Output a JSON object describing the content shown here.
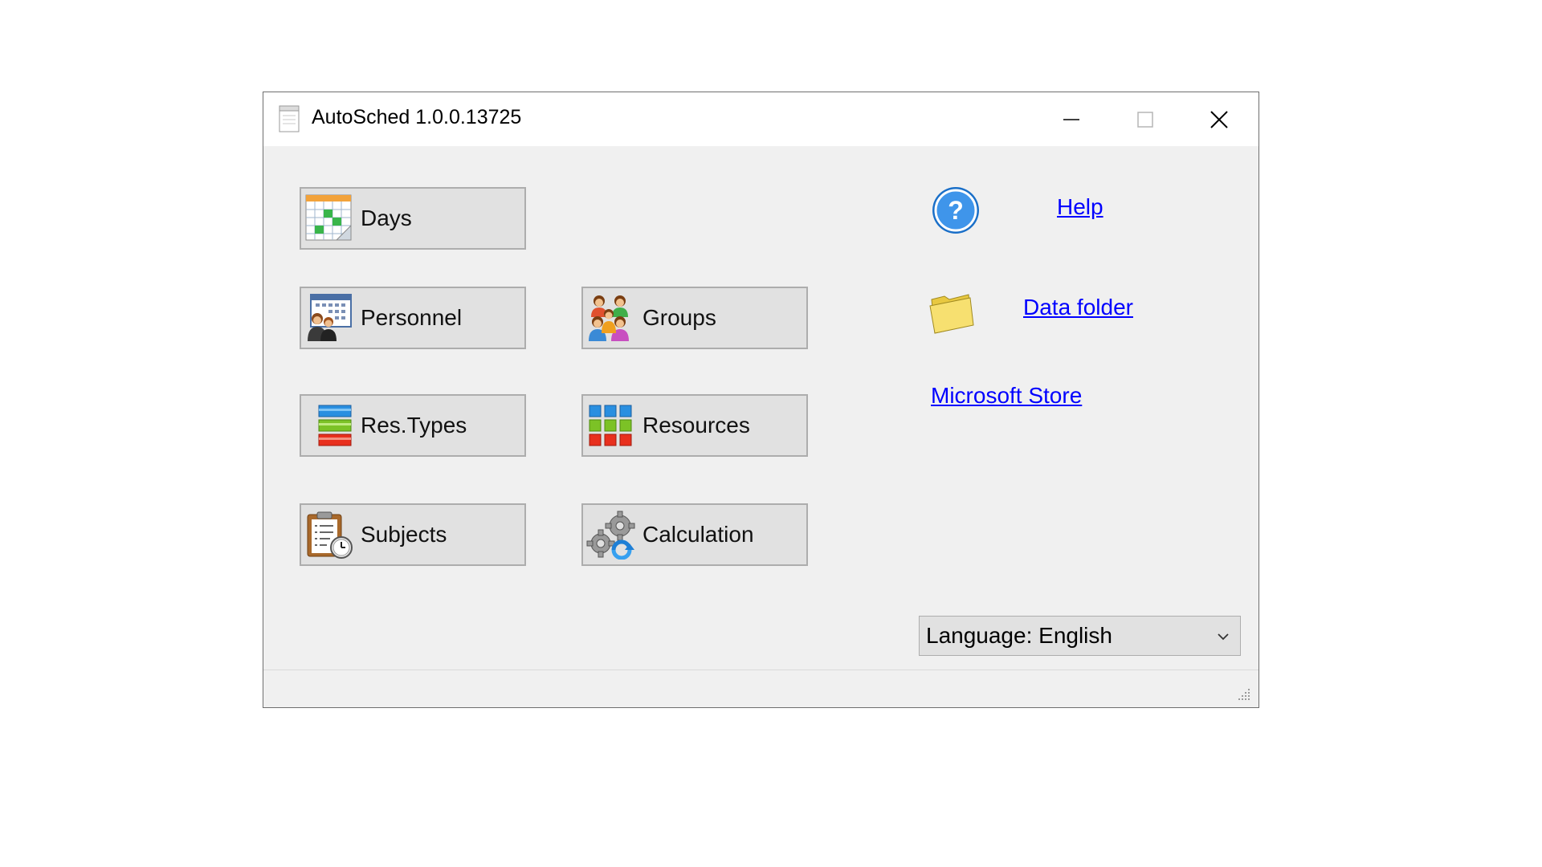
{
  "window": {
    "title": "AutoSched 1.0.0.13725"
  },
  "tiles": {
    "days": "Days",
    "personnel": "Personnel",
    "groups": "Groups",
    "res_types": "Res.Types",
    "resources": "Resources",
    "subjects": "Subjects",
    "calculation": "Calculation"
  },
  "links": {
    "help": "Help",
    "data_folder": "Data folder",
    "microsoft_store": "Microsoft Store"
  },
  "language": {
    "selected": "Language: English"
  },
  "icons": {
    "app": "app-document-icon",
    "days": "calendar-icon",
    "personnel": "personnel-icon",
    "groups": "group-people-icon",
    "res_types": "stacked-bars-icon",
    "resources": "colored-grid-icon",
    "subjects": "clipboard-clock-icon",
    "calculation": "gears-icon",
    "help": "help-question-icon",
    "data_folder": "folder-icon"
  },
  "colors": {
    "link": "#0000ff",
    "button_face": "#e1e1e1",
    "window_bg": "#f0f0f0"
  }
}
